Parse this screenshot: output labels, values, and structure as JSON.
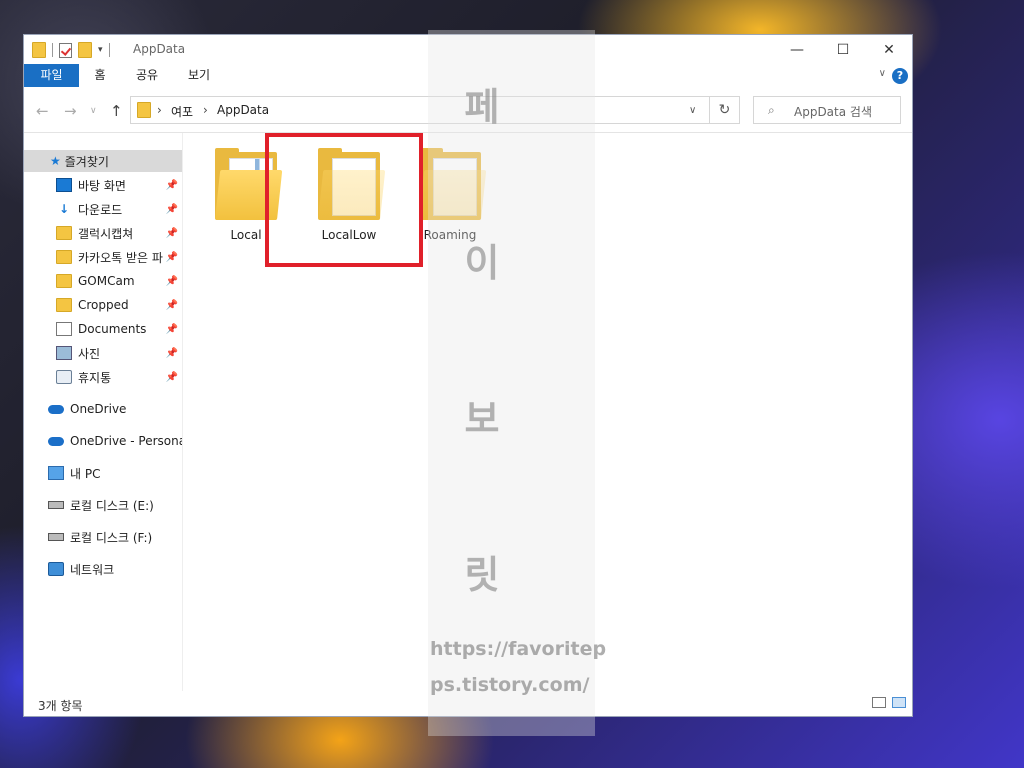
{
  "window": {
    "title": "AppData",
    "controls": {
      "minimize": "—",
      "maximize": "☐",
      "close": "✕"
    }
  },
  "ribbon": {
    "tabs": [
      {
        "label": "파일",
        "active": true
      },
      {
        "label": "홈"
      },
      {
        "label": "공유"
      },
      {
        "label": "보기"
      }
    ],
    "help": "?"
  },
  "address": {
    "crumbs": [
      "여포",
      "AppData"
    ],
    "search_placeholder": "AppData 검색"
  },
  "navpane": {
    "quick_access": "즐겨찾기",
    "pinned": [
      {
        "label": "바탕 화면",
        "icon": "desktop-icon"
      },
      {
        "label": "다운로드",
        "icon": "download-arrow-icon"
      },
      {
        "label": "갤럭시캡쳐",
        "icon": "folder-icon"
      },
      {
        "label": "카카오톡 받은 파",
        "icon": "folder-icon"
      },
      {
        "label": "GOMCam",
        "icon": "folder-icon"
      },
      {
        "label": "Cropped",
        "icon": "folder-icon"
      },
      {
        "label": "Documents",
        "icon": "document-icon"
      },
      {
        "label": "사진",
        "icon": "pictures-icon"
      },
      {
        "label": "휴지통",
        "icon": "recycle-bin-icon"
      }
    ],
    "locations": [
      {
        "label": "OneDrive",
        "icon": "cloud-icon"
      },
      {
        "label": "OneDrive - Personal",
        "icon": "cloud-icon"
      },
      {
        "label": "내 PC",
        "icon": "pc-icon"
      },
      {
        "label": "로컬 디스크 (E:)",
        "icon": "drive-icon"
      },
      {
        "label": "로컬 디스크 (F:)",
        "icon": "drive-icon"
      },
      {
        "label": "네트워크",
        "icon": "network-icon"
      }
    ]
  },
  "files": [
    {
      "name": "Local"
    },
    {
      "name": "LocalLow",
      "highlighted": true
    },
    {
      "name": "Roaming"
    }
  ],
  "status": {
    "count": "3개 항목"
  },
  "watermark": {
    "chars": [
      "페",
      "이",
      "보",
      "릿"
    ],
    "url_lines": [
      "https://favoritep",
      "ps.tistory.com/"
    ]
  },
  "colors": {
    "accent": "#1a6fc4",
    "highlight_border": "#e0202a",
    "folder": "#f2c13e"
  }
}
